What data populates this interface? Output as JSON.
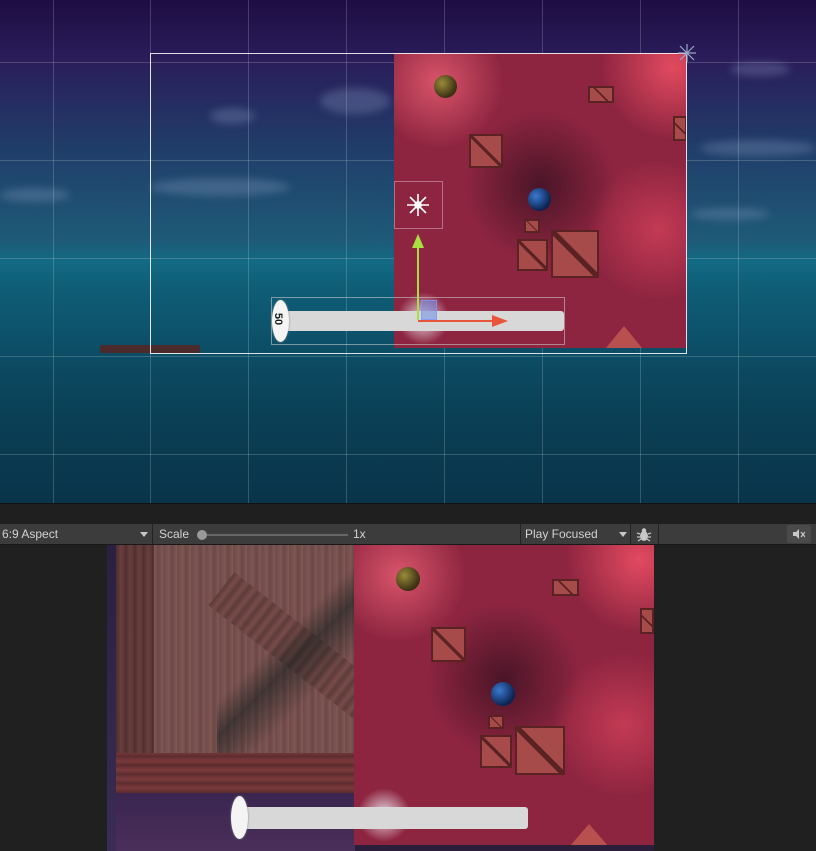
{
  "scene_view": {
    "handle_label": "50"
  },
  "game_view": {
    "toolbar": {
      "aspect": "6:9 Aspect",
      "scale_label": "Scale",
      "scale_value": "1x",
      "play_mode": "Play Focused"
    }
  },
  "icons": {
    "aspect_dropdown": "chevron-down-icon",
    "play_mode_dropdown": "chevron-down-icon",
    "debug": "bug-icon",
    "mute": "audio-mute-icon",
    "gizmo": "wind-zone-icon",
    "move_y": "arrow-up-icon",
    "move_x": "arrow-right-icon"
  },
  "colors": {
    "toolbar_bg": "#3c3c3c",
    "panel_bg": "#282828",
    "gizmo_x": "#e8553a",
    "gizmo_y": "#a8e040",
    "selection": "#6e8ce6"
  }
}
